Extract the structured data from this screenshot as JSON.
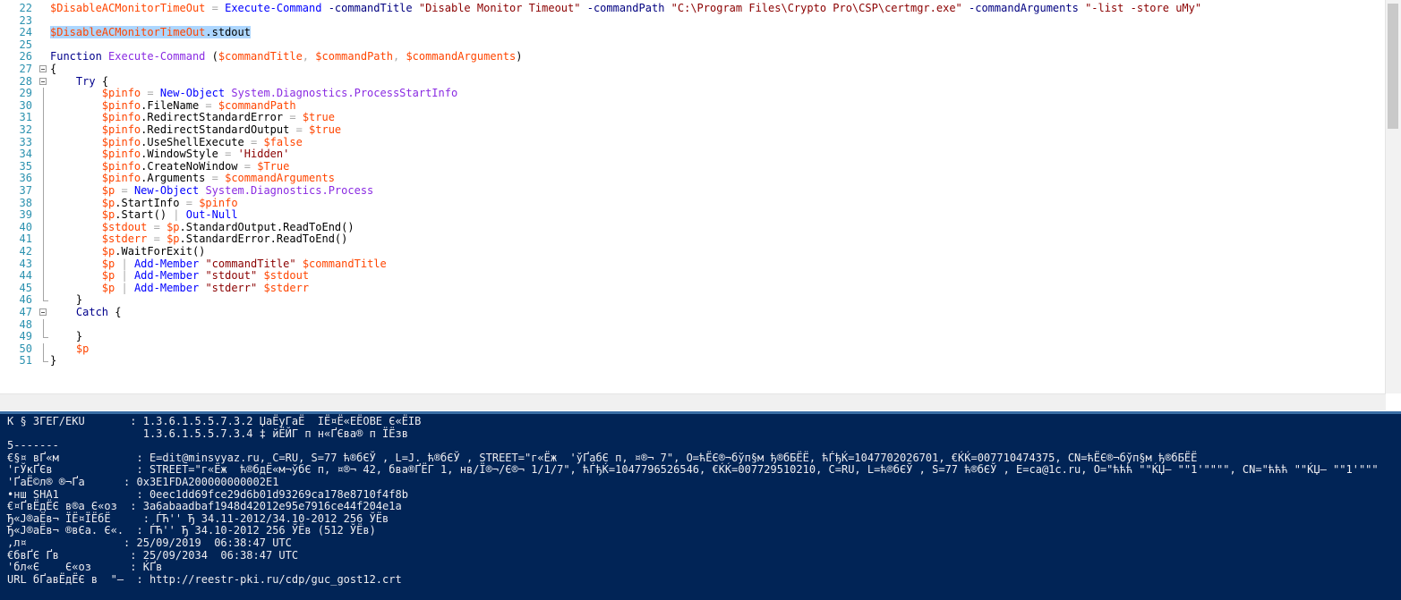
{
  "editor": {
    "selected_line": 24,
    "lines": [
      {
        "n": "22",
        "fold": "",
        "tokens": [
          {
            "c": "var",
            "t": "$DisableACMonitorTimeOut"
          },
          {
            "c": "plain",
            "t": " "
          },
          {
            "c": "op",
            "t": "="
          },
          {
            "c": "plain",
            "t": " "
          },
          {
            "c": "cmd",
            "t": "Execute-Command"
          },
          {
            "c": "plain",
            "t": " "
          },
          {
            "c": "param",
            "t": "-commandTitle"
          },
          {
            "c": "plain",
            "t": " "
          },
          {
            "c": "str",
            "t": "\"Disable Monitor Timeout\""
          },
          {
            "c": "plain",
            "t": " "
          },
          {
            "c": "param",
            "t": "-commandPath"
          },
          {
            "c": "plain",
            "t": " "
          },
          {
            "c": "str",
            "t": "\"C:\\Program Files\\Crypto Pro\\CSP\\certmgr.exe\""
          },
          {
            "c": "plain",
            "t": " "
          },
          {
            "c": "param",
            "t": "-commandArguments"
          },
          {
            "c": "plain",
            "t": " "
          },
          {
            "c": "str",
            "t": "\"-list -store uMy\""
          }
        ]
      },
      {
        "n": "23",
        "fold": "",
        "tokens": []
      },
      {
        "n": "24",
        "fold": "",
        "tokens": [
          {
            "c": "var",
            "t": "$DisableACMonitorTimeOut"
          },
          {
            "c": "prop",
            "t": ".stdout"
          }
        ]
      },
      {
        "n": "25",
        "fold": "",
        "tokens": []
      },
      {
        "n": "26",
        "fold": "",
        "tokens": [
          {
            "c": "kw",
            "t": "Function"
          },
          {
            "c": "plain",
            "t": " "
          },
          {
            "c": "type",
            "t": "Execute-Command"
          },
          {
            "c": "plain",
            "t": " "
          },
          {
            "c": "plain",
            "t": "("
          },
          {
            "c": "var",
            "t": "$commandTitle"
          },
          {
            "c": "op",
            "t": ","
          },
          {
            "c": "plain",
            "t": " "
          },
          {
            "c": "var",
            "t": "$commandPath"
          },
          {
            "c": "op",
            "t": ","
          },
          {
            "c": "plain",
            "t": " "
          },
          {
            "c": "var",
            "t": "$commandArguments"
          },
          {
            "c": "plain",
            "t": ")"
          }
        ]
      },
      {
        "n": "27",
        "fold": "box",
        "tokens": [
          {
            "c": "plain",
            "t": "{"
          }
        ]
      },
      {
        "n": "28",
        "fold": "box",
        "tokens": [
          {
            "c": "plain",
            "t": "    "
          },
          {
            "c": "kw",
            "t": "Try"
          },
          {
            "c": "plain",
            "t": " {"
          }
        ]
      },
      {
        "n": "29",
        "fold": "v",
        "tokens": [
          {
            "c": "plain",
            "t": "        "
          },
          {
            "c": "var",
            "t": "$pinfo"
          },
          {
            "c": "plain",
            "t": " "
          },
          {
            "c": "op",
            "t": "="
          },
          {
            "c": "plain",
            "t": " "
          },
          {
            "c": "cmd",
            "t": "New-Object"
          },
          {
            "c": "plain",
            "t": " "
          },
          {
            "c": "type",
            "t": "System.Diagnostics.ProcessStartInfo"
          }
        ]
      },
      {
        "n": "30",
        "fold": "v",
        "tokens": [
          {
            "c": "plain",
            "t": "        "
          },
          {
            "c": "var",
            "t": "$pinfo"
          },
          {
            "c": "prop",
            "t": ".FileName"
          },
          {
            "c": "plain",
            "t": " "
          },
          {
            "c": "op",
            "t": "="
          },
          {
            "c": "plain",
            "t": " "
          },
          {
            "c": "var",
            "t": "$commandPath"
          }
        ]
      },
      {
        "n": "31",
        "fold": "v",
        "tokens": [
          {
            "c": "plain",
            "t": "        "
          },
          {
            "c": "var",
            "t": "$pinfo"
          },
          {
            "c": "prop",
            "t": ".RedirectStandardError"
          },
          {
            "c": "plain",
            "t": " "
          },
          {
            "c": "op",
            "t": "="
          },
          {
            "c": "plain",
            "t": " "
          },
          {
            "c": "var",
            "t": "$true"
          }
        ]
      },
      {
        "n": "32",
        "fold": "v",
        "tokens": [
          {
            "c": "plain",
            "t": "        "
          },
          {
            "c": "var",
            "t": "$pinfo"
          },
          {
            "c": "prop",
            "t": ".RedirectStandardOutput"
          },
          {
            "c": "plain",
            "t": " "
          },
          {
            "c": "op",
            "t": "="
          },
          {
            "c": "plain",
            "t": " "
          },
          {
            "c": "var",
            "t": "$true"
          }
        ]
      },
      {
        "n": "33",
        "fold": "v",
        "tokens": [
          {
            "c": "plain",
            "t": "        "
          },
          {
            "c": "var",
            "t": "$pinfo"
          },
          {
            "c": "prop",
            "t": ".UseShellExecute"
          },
          {
            "c": "plain",
            "t": " "
          },
          {
            "c": "op",
            "t": "="
          },
          {
            "c": "plain",
            "t": " "
          },
          {
            "c": "var",
            "t": "$false"
          }
        ]
      },
      {
        "n": "34",
        "fold": "v",
        "tokens": [
          {
            "c": "plain",
            "t": "        "
          },
          {
            "c": "var",
            "t": "$pinfo"
          },
          {
            "c": "prop",
            "t": ".WindowStyle"
          },
          {
            "c": "plain",
            "t": " "
          },
          {
            "c": "op",
            "t": "="
          },
          {
            "c": "plain",
            "t": " "
          },
          {
            "c": "str",
            "t": "'Hidden'"
          }
        ]
      },
      {
        "n": "35",
        "fold": "v",
        "tokens": [
          {
            "c": "plain",
            "t": "        "
          },
          {
            "c": "var",
            "t": "$pinfo"
          },
          {
            "c": "prop",
            "t": ".CreateNoWindow"
          },
          {
            "c": "plain",
            "t": " "
          },
          {
            "c": "op",
            "t": "="
          },
          {
            "c": "plain",
            "t": " "
          },
          {
            "c": "var",
            "t": "$True"
          }
        ]
      },
      {
        "n": "36",
        "fold": "v",
        "tokens": [
          {
            "c": "plain",
            "t": "        "
          },
          {
            "c": "var",
            "t": "$pinfo"
          },
          {
            "c": "prop",
            "t": ".Arguments"
          },
          {
            "c": "plain",
            "t": " "
          },
          {
            "c": "op",
            "t": "="
          },
          {
            "c": "plain",
            "t": " "
          },
          {
            "c": "var",
            "t": "$commandArguments"
          }
        ]
      },
      {
        "n": "37",
        "fold": "v",
        "tokens": [
          {
            "c": "plain",
            "t": "        "
          },
          {
            "c": "var",
            "t": "$p"
          },
          {
            "c": "plain",
            "t": " "
          },
          {
            "c": "op",
            "t": "="
          },
          {
            "c": "plain",
            "t": " "
          },
          {
            "c": "cmd",
            "t": "New-Object"
          },
          {
            "c": "plain",
            "t": " "
          },
          {
            "c": "type",
            "t": "System.Diagnostics.Process"
          }
        ]
      },
      {
        "n": "38",
        "fold": "v",
        "tokens": [
          {
            "c": "plain",
            "t": "        "
          },
          {
            "c": "var",
            "t": "$p"
          },
          {
            "c": "prop",
            "t": ".StartInfo"
          },
          {
            "c": "plain",
            "t": " "
          },
          {
            "c": "op",
            "t": "="
          },
          {
            "c": "plain",
            "t": " "
          },
          {
            "c": "var",
            "t": "$pinfo"
          }
        ]
      },
      {
        "n": "39",
        "fold": "v",
        "tokens": [
          {
            "c": "plain",
            "t": "        "
          },
          {
            "c": "var",
            "t": "$p"
          },
          {
            "c": "prop",
            "t": ".Start()"
          },
          {
            "c": "plain",
            "t": " "
          },
          {
            "c": "op",
            "t": "|"
          },
          {
            "c": "plain",
            "t": " "
          },
          {
            "c": "cmd",
            "t": "Out-Null"
          }
        ]
      },
      {
        "n": "40",
        "fold": "v",
        "tokens": [
          {
            "c": "plain",
            "t": "        "
          },
          {
            "c": "var",
            "t": "$stdout"
          },
          {
            "c": "plain",
            "t": " "
          },
          {
            "c": "op",
            "t": "="
          },
          {
            "c": "plain",
            "t": " "
          },
          {
            "c": "var",
            "t": "$p"
          },
          {
            "c": "prop",
            "t": ".StandardOutput.ReadToEnd()"
          }
        ]
      },
      {
        "n": "41",
        "fold": "v",
        "tokens": [
          {
            "c": "plain",
            "t": "        "
          },
          {
            "c": "var",
            "t": "$stderr"
          },
          {
            "c": "plain",
            "t": " "
          },
          {
            "c": "op",
            "t": "="
          },
          {
            "c": "plain",
            "t": " "
          },
          {
            "c": "var",
            "t": "$p"
          },
          {
            "c": "prop",
            "t": ".StandardError.ReadToEnd()"
          }
        ]
      },
      {
        "n": "42",
        "fold": "v",
        "tokens": [
          {
            "c": "plain",
            "t": "        "
          },
          {
            "c": "var",
            "t": "$p"
          },
          {
            "c": "prop",
            "t": ".WaitForExit()"
          }
        ]
      },
      {
        "n": "43",
        "fold": "v",
        "tokens": [
          {
            "c": "plain",
            "t": "        "
          },
          {
            "c": "var",
            "t": "$p"
          },
          {
            "c": "plain",
            "t": " "
          },
          {
            "c": "op",
            "t": "|"
          },
          {
            "c": "plain",
            "t": " "
          },
          {
            "c": "cmd",
            "t": "Add-Member"
          },
          {
            "c": "plain",
            "t": " "
          },
          {
            "c": "str",
            "t": "\"commandTitle\""
          },
          {
            "c": "plain",
            "t": " "
          },
          {
            "c": "var",
            "t": "$commandTitle"
          }
        ]
      },
      {
        "n": "44",
        "fold": "v",
        "tokens": [
          {
            "c": "plain",
            "t": "        "
          },
          {
            "c": "var",
            "t": "$p"
          },
          {
            "c": "plain",
            "t": " "
          },
          {
            "c": "op",
            "t": "|"
          },
          {
            "c": "plain",
            "t": " "
          },
          {
            "c": "cmd",
            "t": "Add-Member"
          },
          {
            "c": "plain",
            "t": " "
          },
          {
            "c": "str",
            "t": "\"stdout\""
          },
          {
            "c": "plain",
            "t": " "
          },
          {
            "c": "var",
            "t": "$stdout"
          }
        ]
      },
      {
        "n": "45",
        "fold": "v",
        "tokens": [
          {
            "c": "plain",
            "t": "        "
          },
          {
            "c": "var",
            "t": "$p"
          },
          {
            "c": "plain",
            "t": " "
          },
          {
            "c": "op",
            "t": "|"
          },
          {
            "c": "plain",
            "t": " "
          },
          {
            "c": "cmd",
            "t": "Add-Member"
          },
          {
            "c": "plain",
            "t": " "
          },
          {
            "c": "str",
            "t": "\"stderr\""
          },
          {
            "c": "plain",
            "t": " "
          },
          {
            "c": "var",
            "t": "$stderr"
          }
        ]
      },
      {
        "n": "46",
        "fold": "end",
        "tokens": [
          {
            "c": "plain",
            "t": "    }"
          }
        ]
      },
      {
        "n": "47",
        "fold": "box",
        "tokens": [
          {
            "c": "plain",
            "t": "    "
          },
          {
            "c": "kw",
            "t": "Catch"
          },
          {
            "c": "plain",
            "t": " {"
          }
        ]
      },
      {
        "n": "48",
        "fold": "v",
        "tokens": []
      },
      {
        "n": "49",
        "fold": "end",
        "tokens": [
          {
            "c": "plain",
            "t": "    }"
          }
        ]
      },
      {
        "n": "50",
        "fold": "v",
        "tokens": [
          {
            "c": "plain",
            "t": "    "
          },
          {
            "c": "var",
            "t": "$p"
          }
        ]
      },
      {
        "n": "51",
        "fold": "end",
        "tokens": [
          {
            "c": "plain",
            "t": "}"
          }
        ]
      }
    ]
  },
  "console": {
    "lines": [
      "K § ЗГЕГ/EKU       : 1.3.6.1.5.5.7.3.2 ЏаЁуГаЁ  ІЁ¤Ё«ЕЁОВЕ Є«ЁІВ",
      "                     1.3.6.1.5.5.7.3.4 ‡ йЁЙГ п н«ҐЄва® п ЇЁзв",
      "5-------",
      "€§¤ вҐ«м            : E=dit@minsvyaz.ru, C=RU, S=77 ћ®бЄЎ , L=J. ћ®бЄЎ , STREET=\"г«Ёж  'ўҐабЄ п, ¤®¬ 7\", O=ћЁЄ®¬бўп§м ђ®бБЁЁ, ћЃђЌ=1047702026701, €ЌЌ=007710474375, CN=ћЁЄ®¬бўп§м ђ®бБЁЁ",
      "'гЎкҐЄв             : STREET=\"г«Ёж  ћ®бдЁ«м¬ўбЄ п, ¤®¬ 42, бва®ҐЁГ 1, нв/Ї®¬/Є®¬ 1/1/7\", ћЃђЌ=1047796526546, €ЌЌ=007729510210, C=RU, L=ћ®бЄЎ , S=77 ћ®бЄЎ , E=ca@1c.ru, O=\"ћћћ \"\"ЌЏ– \"\"1'\"\"\"\", CN=\"ћћћ \"\"ЌЏ– \"\"1'\"\"\"",
      "'ҐаЁ©л® ®¬Ґа      : 0x3E1FDA200000000002E1",
      "•нш SHA1            : 0eec1dd69fce29d6b01d93269ca178e8710f4f8b",
      "€¤ҐвЁдЁЄ в®а Є«оз  : 3a6abaadbaf1948d42012e95e7916ce44f204e1a",
      "Ђ«Ј®аЁв¬ ЇЁ¤ЇЁбЁ     : ЃЋ'' Ђ 34.11-2012/34.10-2012 256 ЎЁв",
      "Ђ«Ј®аЁв¬ ®вЄа. Є«.  : ЃЋ'' Ђ 34.10-2012 256 ЎЁв (512 ЎЁв)",
      ",л¤               : 25/09/2019  06:38:47 UTC",
      "€бвҐЄ Ґв           : 25/09/2034  06:38:47 UTC",
      "'бл«Є    Є«оз      : ЌҐв",
      "URL бҐавЁдЁЄ в  \"–  : http://reestr-pki.ru/cdp/guc_gost12.crt"
    ]
  },
  "colors": {
    "editor_bg": "#ffffff",
    "console_bg": "#012456",
    "console_fg": "#eeedf0",
    "line_number": "#2b91af",
    "selection": "#add6ff"
  }
}
